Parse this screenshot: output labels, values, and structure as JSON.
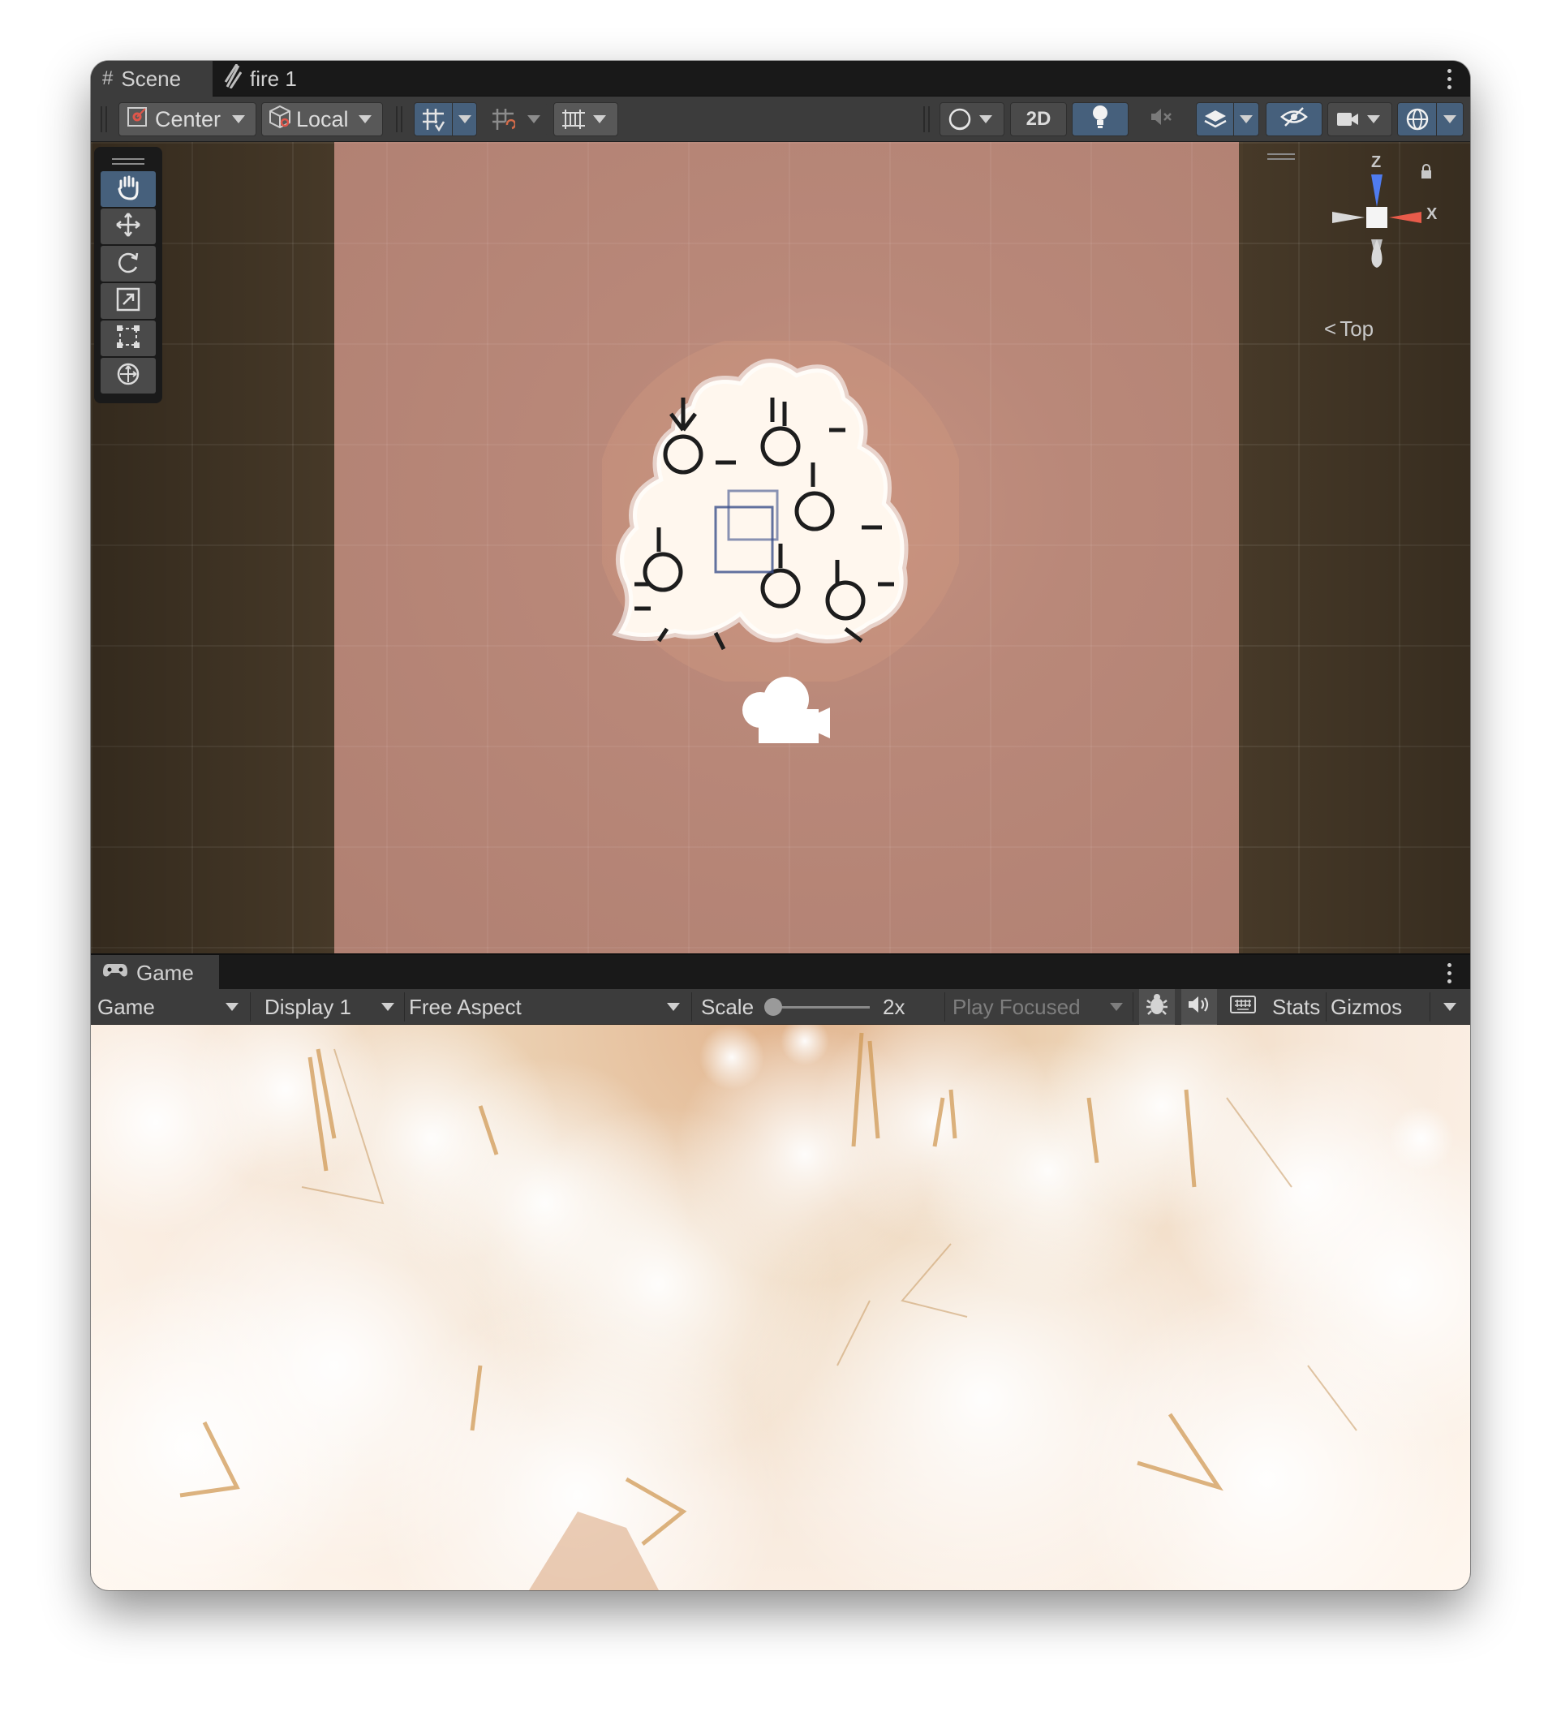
{
  "scene_panel": {
    "tabs": [
      {
        "label": "Scene",
        "icon": "hash-grid-icon"
      },
      {
        "label": "fire 1",
        "icon": "fire-icon"
      }
    ],
    "toolbar": {
      "pivot_label": "Center",
      "space_label": "Local",
      "mode_2d_label": "2D"
    },
    "tools": [
      "hand-tool-icon",
      "move-tool-icon",
      "rotate-tool-icon",
      "scale-tool-icon",
      "rect-tool-icon",
      "transform-tool-icon"
    ],
    "gizmo": {
      "z_label": "Z",
      "x_label": "X",
      "view_label": "Top"
    }
  },
  "game_panel": {
    "tab_label": "Game",
    "toolbar": {
      "view_select": "Game",
      "display_select": "Display 1",
      "aspect_select": "Free Aspect",
      "scale_label": "Scale",
      "scale_value": "2x",
      "play_mode_select": "Play Focused",
      "stats_label": "Stats",
      "gizmos_label": "Gizmos"
    }
  },
  "colors": {
    "active_blue": "#46607c",
    "scene_background": "#4a3c2a",
    "canvas_tint": "#b98879",
    "gizmo_z": "#4f7cf0",
    "gizmo_x": "#e85b4a"
  }
}
